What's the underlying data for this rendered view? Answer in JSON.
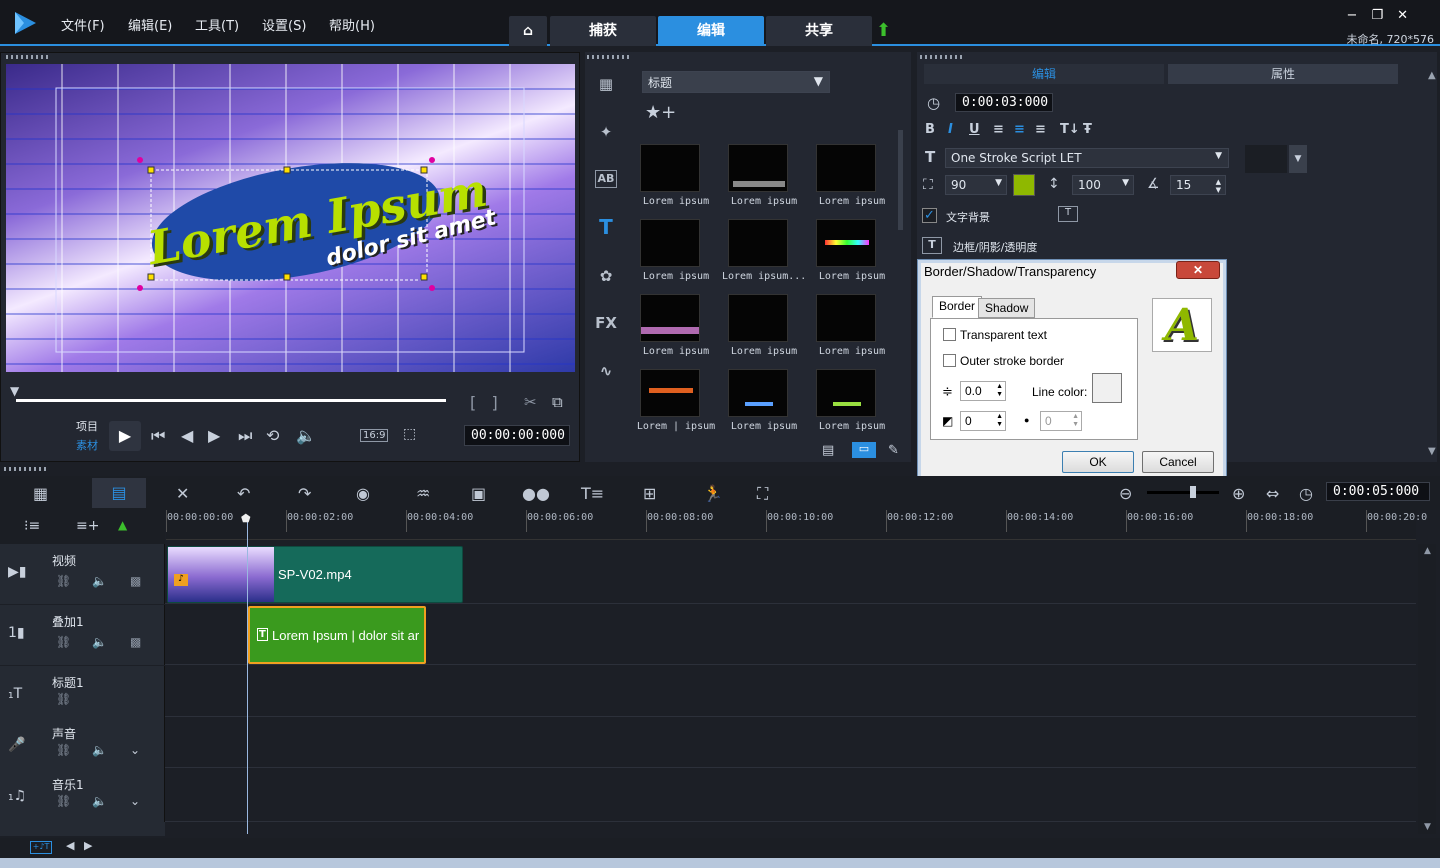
{
  "window": {
    "menu": [
      "文件(F)",
      "编辑(E)",
      "工具(T)",
      "设置(S)",
      "帮助(H)"
    ],
    "nav_tabs": [
      "捕获",
      "编辑",
      "共享"
    ],
    "active_nav": "编辑",
    "project_info": "未命名, 720*576"
  },
  "preview": {
    "overlay_text_main": "Lorem Ipsum",
    "overlay_text_sub": "dolor sit amet",
    "mode_project": "项目",
    "mode_clip": "素材",
    "aspect": "16:9",
    "timecode": "00:00:00:000"
  },
  "library": {
    "category": "标题",
    "thumbnails": [
      "Lorem ipsum",
      "Lorem ipsum",
      "Lorem ipsum",
      "Lorem ipsum",
      "Lorem ipsum...",
      "Lorem ipsum",
      "Lorem ipsum",
      "Lorem ipsum",
      "Lorem ipsum",
      "Lorem | ipsum",
      "Lorem ipsum",
      "Lorem ipsum"
    ]
  },
  "options": {
    "tab_edit": "编辑",
    "tab_attr": "属性",
    "duration": "0:00:03:000",
    "font": "One Stroke Script LET",
    "font_size": "90",
    "line_spacing": "100",
    "angle": "15",
    "text_bg_label": "文字背景",
    "border_label": "边框/阴影/透明度",
    "color_swatch": "#8fb800"
  },
  "dialog": {
    "title": "Border/Shadow/Transparency",
    "tab_border": "Border",
    "tab_shadow": "Shadow",
    "transparent_text": "Transparent text",
    "outer_stroke": "Outer stroke border",
    "border_width": "0.0",
    "line_color_label": "Line color:",
    "soft_edge": "0",
    "transparency": "0",
    "ok": "OK",
    "cancel": "Cancel",
    "preview_letter": "A"
  },
  "timeline": {
    "total_time": "0:00:05:000",
    "ruler": [
      "00:00:00:00",
      "00:00:02:00",
      "00:00:04:00",
      "00:00:06:00",
      "00:00:08:00",
      "00:00:10:00",
      "00:00:12:00",
      "00:00:14:00",
      "00:00:16:00",
      "00:00:18:00",
      "00:00:20:0"
    ],
    "tracks": [
      "视频",
      "叠加1",
      "标题1",
      "声音",
      "音乐1"
    ],
    "video_clip": "SP-V02.mp4",
    "overlay_clip": "Lorem Ipsum | dolor sit ar"
  }
}
